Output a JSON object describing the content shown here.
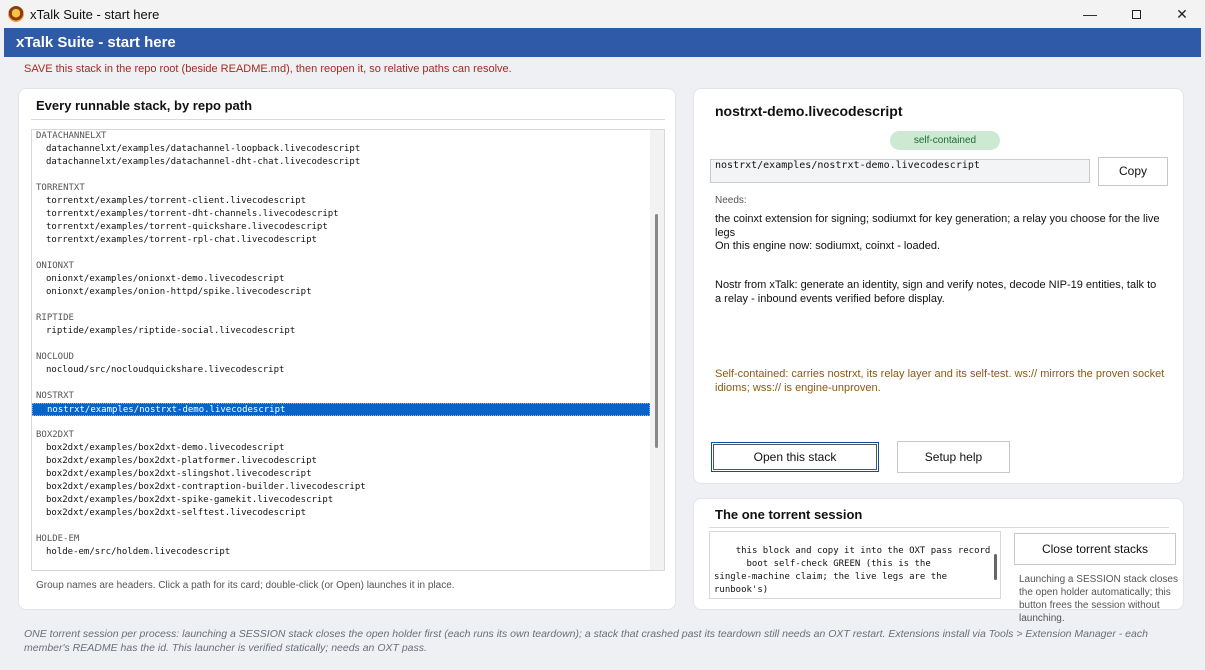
{
  "window": {
    "title": "xTalk Suite - start here",
    "controls": {
      "minimize": "—",
      "close": "✕"
    }
  },
  "header": {
    "title": "xTalk Suite - start here"
  },
  "warning": "SAVE this stack in the repo root (beside README.md), then reopen it, so relative paths can resolve.",
  "stacks_panel": {
    "title": "Every runnable stack, by repo path",
    "groups": [
      {
        "name": "DATACHANNELXT",
        "paths": [
          "datachannelxt/examples/datachannel-loopback.livecodescript",
          "datachannelxt/examples/datachannel-dht-chat.livecodescript"
        ]
      },
      {
        "name": "TORRENTXT",
        "paths": [
          "torrentxt/examples/torrent-client.livecodescript",
          "torrentxt/examples/torrent-dht-channels.livecodescript",
          "torrentxt/examples/torrent-quickshare.livecodescript",
          "torrentxt/examples/torrent-rpl-chat.livecodescript"
        ]
      },
      {
        "name": "ONIONXT",
        "paths": [
          "onionxt/examples/onionxt-demo.livecodescript",
          "onionxt/examples/onion-httpd/spike.livecodescript"
        ]
      },
      {
        "name": "RIPTIDE",
        "paths": [
          "riptide/examples/riptide-social.livecodescript"
        ]
      },
      {
        "name": "NOCLOUD",
        "paths": [
          "nocloud/src/nocloudquickshare.livecodescript"
        ]
      },
      {
        "name": "NOSTRXT",
        "paths": [
          "nostrxt/examples/nostrxt-demo.livecodescript"
        ]
      },
      {
        "name": "BOX2DXT",
        "paths": [
          "box2dxt/examples/box2dxt-demo.livecodescript",
          "box2dxt/examples/box2dxt-platformer.livecodescript",
          "box2dxt/examples/box2dxt-slingshot.livecodescript",
          "box2dxt/examples/box2dxt-contraption-builder.livecodescript",
          "box2dxt/examples/box2dxt-spike-gamekit.livecodescript",
          "box2dxt/examples/box2dxt-selftest.livecodescript"
        ]
      },
      {
        "name": "HOLDE-EM",
        "paths": [
          "holde-em/src/holdem.livecodescript"
        ]
      }
    ],
    "selected_path": "nostrxt/examples/nostrxt-demo.livecodescript",
    "hint": "Group names are headers. Click a path for its card; double-click (or Open) launches it in place."
  },
  "card": {
    "title": "nostrxt-demo.livecodescript",
    "badge": "self-contained",
    "path": "nostrxt/examples/nostrxt-demo.livecodescript",
    "copy_label": "Copy",
    "needs_label": "Needs:",
    "needs_text": "the coinxt extension for signing; sodiumxt for key generation; a relay you choose for the live legs",
    "engine_text": "On this engine now: sodiumxt, coinxt - loaded.",
    "description": "Nostr from xTalk: generate an identity, sign and verify notes, decode NIP-19 entities, talk to a relay - inbound events verified before display.",
    "self_contained_note": "Self-contained: carries nostrxt, its relay layer and its self-test. ws:// mirrors the proven socket idioms; wss:// is engine-unproven.",
    "open_label": "Open this stack",
    "setup_label": "Setup help"
  },
  "torrent": {
    "title": "The one torrent session",
    "log": "this block and copy it into the OXT pass record\n      boot self-check GREEN (this is the\nsingle-machine claim; the live legs are the\nrunbook's)",
    "close_label": "Close torrent stacks",
    "note": "Launching a SESSION stack closes the open holder automatically; this button frees the session without launching."
  },
  "footer": "ONE torrent session per process: launching a SESSION stack closes the open holder first (each runs its own teardown); a stack that crashed past its teardown still needs an OXT restart. Extensions install via Tools > Extension Manager - each member's README has the id. This launcher is verified statically; needs an OXT pass."
}
